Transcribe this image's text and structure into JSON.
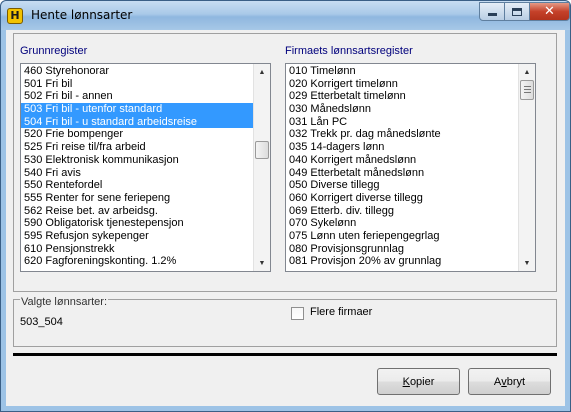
{
  "window": {
    "title": "Hente lønnsarter",
    "app_icon": "H",
    "close_glyph": "✕"
  },
  "left_panel": {
    "label": "Grunnregister",
    "items": [
      "460 Styrehonorar",
      "501 Fri bil",
      "502 Fri bil - annen",
      "503 Fri bil - utenfor standard",
      "504 Fri bil - u standard arbeidsreise",
      "520 Frie bompenger",
      "525 Fri reise til/fra arbeid",
      "530 Elektronisk kommunikasjon",
      "540 Fri avis",
      "550 Rentefordel",
      "555 Renter for sene feriepeng",
      "562 Reise bet. av arbeidsg.",
      "590 Obligatorisk tjenestepensjon",
      "595 Refusjon sykepenger",
      "610 Pensjonstrekk",
      "620 Fagforeningskonting. 1.2%"
    ],
    "selected_indices": [
      3,
      4
    ]
  },
  "right_panel": {
    "label": "Firmaets lønnsartsregister",
    "items": [
      "010 Timelønn",
      "020 Korrigert timelønn",
      "029 Etterbetalt timelønn",
      "030 Månedslønn",
      "031 Lån PC",
      "032 Trekk pr. dag månedslønte",
      "035 14-dagers lønn",
      "040 Korrigert månedslønn",
      "049 Etterbetalt månedslønn",
      "050 Diverse tillegg",
      "060 Korrigert diverse tillegg",
      "069 Etterb. div. tillegg",
      "070 Sykelønn",
      "075 Lønn uten feriepengegrlag",
      "080 Provisjonsgrunnlag",
      "081 Provisjon 20% av grunnlag"
    ]
  },
  "selection": {
    "label": "Valgte lønnsarter:",
    "value": "503_504"
  },
  "options": {
    "flere_firmaer_label": "Flere firmaer",
    "flere_firmaer_checked": false
  },
  "buttons": {
    "copy_hotkey": "K",
    "copy_rest": "opier",
    "cancel_prefix": "A",
    "cancel_hotkey": "v",
    "cancel_rest": "bryt"
  }
}
